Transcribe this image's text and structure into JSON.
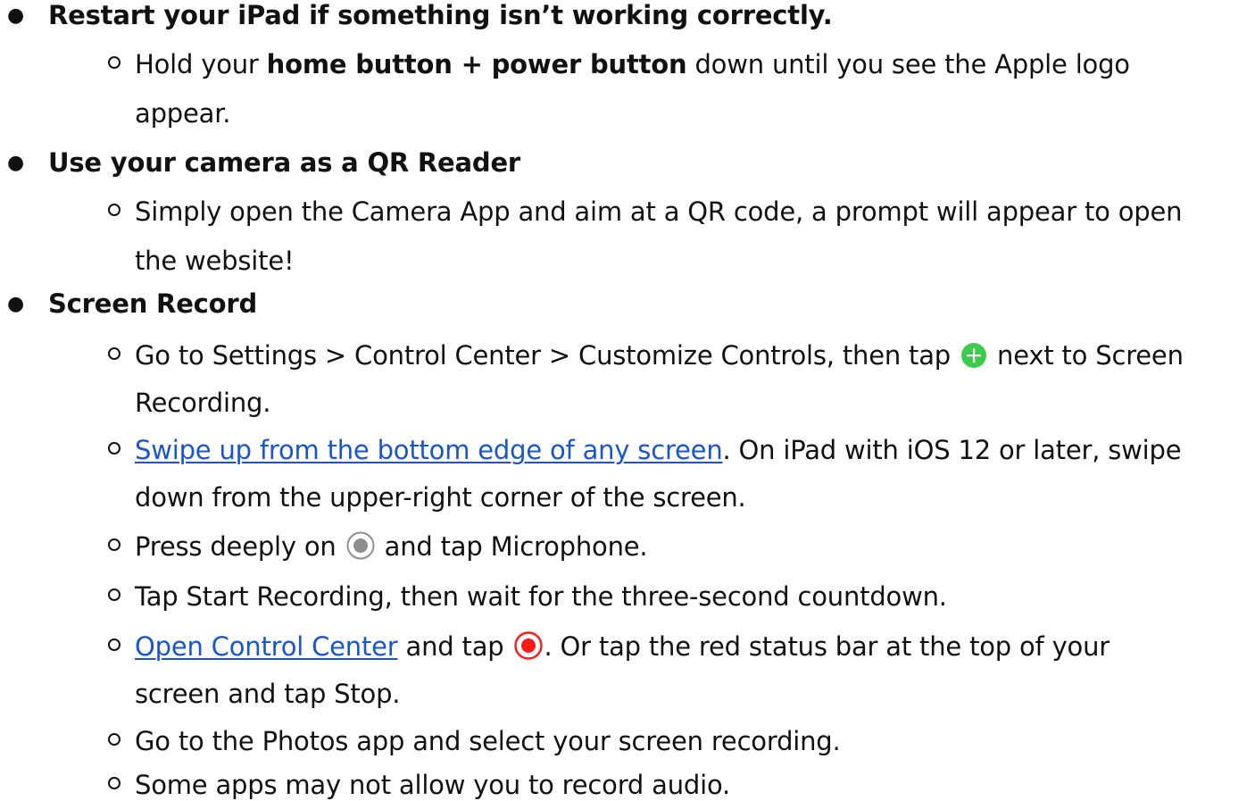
{
  "sections": [
    {
      "heading": "Restart your iPad if something isn’t working correctly.",
      "items": [
        {
          "line1_pre": "Hold your ",
          "line1_bold": "home button + power button",
          "line1_post": " down until you see the Apple logo",
          "line2": "appear."
        }
      ]
    },
    {
      "heading": "Use your camera as a QR Reader",
      "items": [
        {
          "line1": "Simply open the Camera App and aim at a QR code, a prompt will appear to open",
          "line2": "the website!"
        }
      ]
    },
    {
      "heading": "Screen Record",
      "items": [
        {
          "line1_pre": " Go to Settings > Control Center > Customize Controls, then tap",
          "icon": "green-plus-icon",
          "line1_post": " next to Screen",
          "line2": "Recording."
        },
        {
          "link": "Swipe up from the bottom edge of any screen",
          "line1_post": ". On iPad with iOS 12 or later, swipe",
          "line2": "down from the upper-right corner of the screen."
        },
        {
          "line1_pre": "Press deeply on",
          "icon": "gray-record-button-icon",
          "line1_post": " and tap Microphone."
        },
        {
          "line1": "Tap Start Recording, then wait for the three-second countdown."
        },
        {
          "link": "Open Control Center",
          "line1_mid": " and tap",
          "icon": "red-record-button-icon",
          "line1_post": ". Or tap the red status bar at the top of your",
          "line2": "screen and tap Stop."
        },
        {
          "line1": "Go to the Photos app and select your screen recording."
        },
        {
          "line1": "Some apps may not allow you to record audio."
        }
      ]
    }
  ],
  "colors": {
    "text": "#111111",
    "link": "#1a55cc",
    "green_icon": "#3ccb4b",
    "record_gray": "#8e8e8e",
    "record_red": "#ff1a1a"
  }
}
